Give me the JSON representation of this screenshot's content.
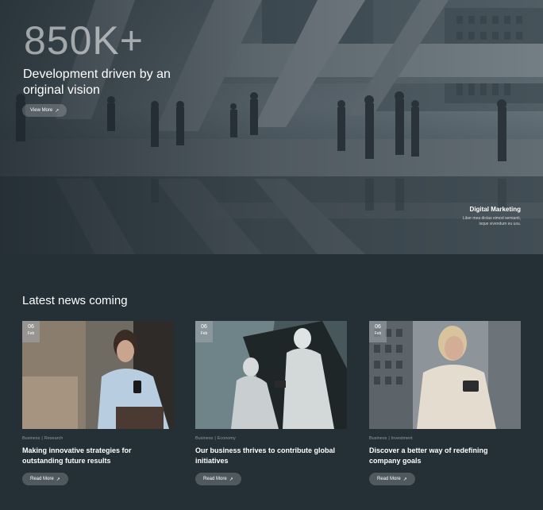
{
  "hero": {
    "stat": "850K+",
    "heading": "Development driven by an original vision",
    "button_label": "View More",
    "button_icon": "arrow-up-right-icon",
    "caption_title": "Digital Marketing",
    "caption_line1": "Liber mea dictas eimod semianti,",
    "caption_line2": "isque vivendum eu usu."
  },
  "news": {
    "title": "Latest news coming",
    "cards": [
      {
        "day": "06",
        "month": "Feb",
        "category1": "Business",
        "separator": "|",
        "category2": "Research",
        "title": "Making innovative strategies for outstanding future results",
        "button_label": "Read More"
      },
      {
        "day": "06",
        "month": "Feb",
        "category1": "Business",
        "separator": "|",
        "category2": "Economy",
        "title": "Our business thrives to contribute global initiatives",
        "button_label": "Read More"
      },
      {
        "day": "06",
        "month": "Feb",
        "category1": "Business",
        "separator": "|",
        "category2": "Investment",
        "title": "Discover a better way of redefining company goals",
        "button_label": "Read More"
      }
    ]
  },
  "colors": {
    "page_background": "#243036",
    "button_background": "rgba(255,255,255,0.20)",
    "meta_text": "#8e9aa0"
  }
}
